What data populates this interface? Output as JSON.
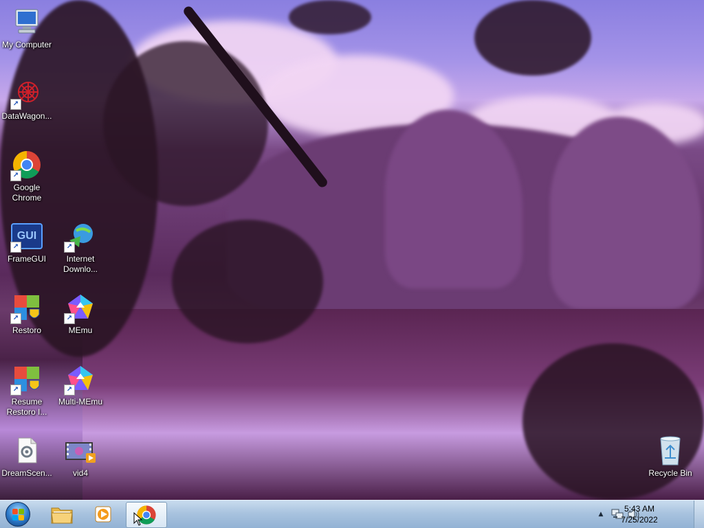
{
  "desktop": {
    "icons": [
      {
        "label": "My Computer",
        "icon": "computer-icon"
      },
      {
        "label": "DataWagon...",
        "icon": "datawagon-icon"
      },
      {
        "label": "Google Chrome",
        "icon": "chrome-icon"
      },
      {
        "label": "FrameGUI",
        "icon": "framegui-icon"
      },
      {
        "label": "Internet Downlo...",
        "icon": "internet-download-manager-icon"
      },
      {
        "label": "Restoro",
        "icon": "restoro-icon"
      },
      {
        "label": "MEmu",
        "icon": "memu-icon"
      },
      {
        "label": "Resume Restoro I...",
        "icon": "restoro-icon"
      },
      {
        "label": "Multi-MEmu",
        "icon": "memu-icon"
      },
      {
        "label": "DreamScen...",
        "icon": "dreamscene-icon"
      },
      {
        "label": "vid4",
        "icon": "video-file-icon"
      },
      {
        "label": "Recycle Bin",
        "icon": "recycle-bin-icon"
      }
    ],
    "framegui_glyph": "GUI"
  },
  "taskbar": {
    "pinned": [
      {
        "name": "windows-explorer",
        "icon": "folder-icon"
      },
      {
        "name": "media-player",
        "icon": "media-player-icon"
      },
      {
        "name": "google-chrome",
        "icon": "chrome-icon",
        "active": true
      }
    ],
    "tray": {
      "up_arrow": "▲",
      "network_icon": "network-icon",
      "volume_icon": "volume-icon"
    },
    "clock": {
      "time": "5:43 AM",
      "date": "7/25/2022"
    }
  },
  "colors": {
    "taskbar_top": "#c9dcee",
    "taskbar_bottom": "#93b2d4",
    "label_text": "#ffffff"
  }
}
